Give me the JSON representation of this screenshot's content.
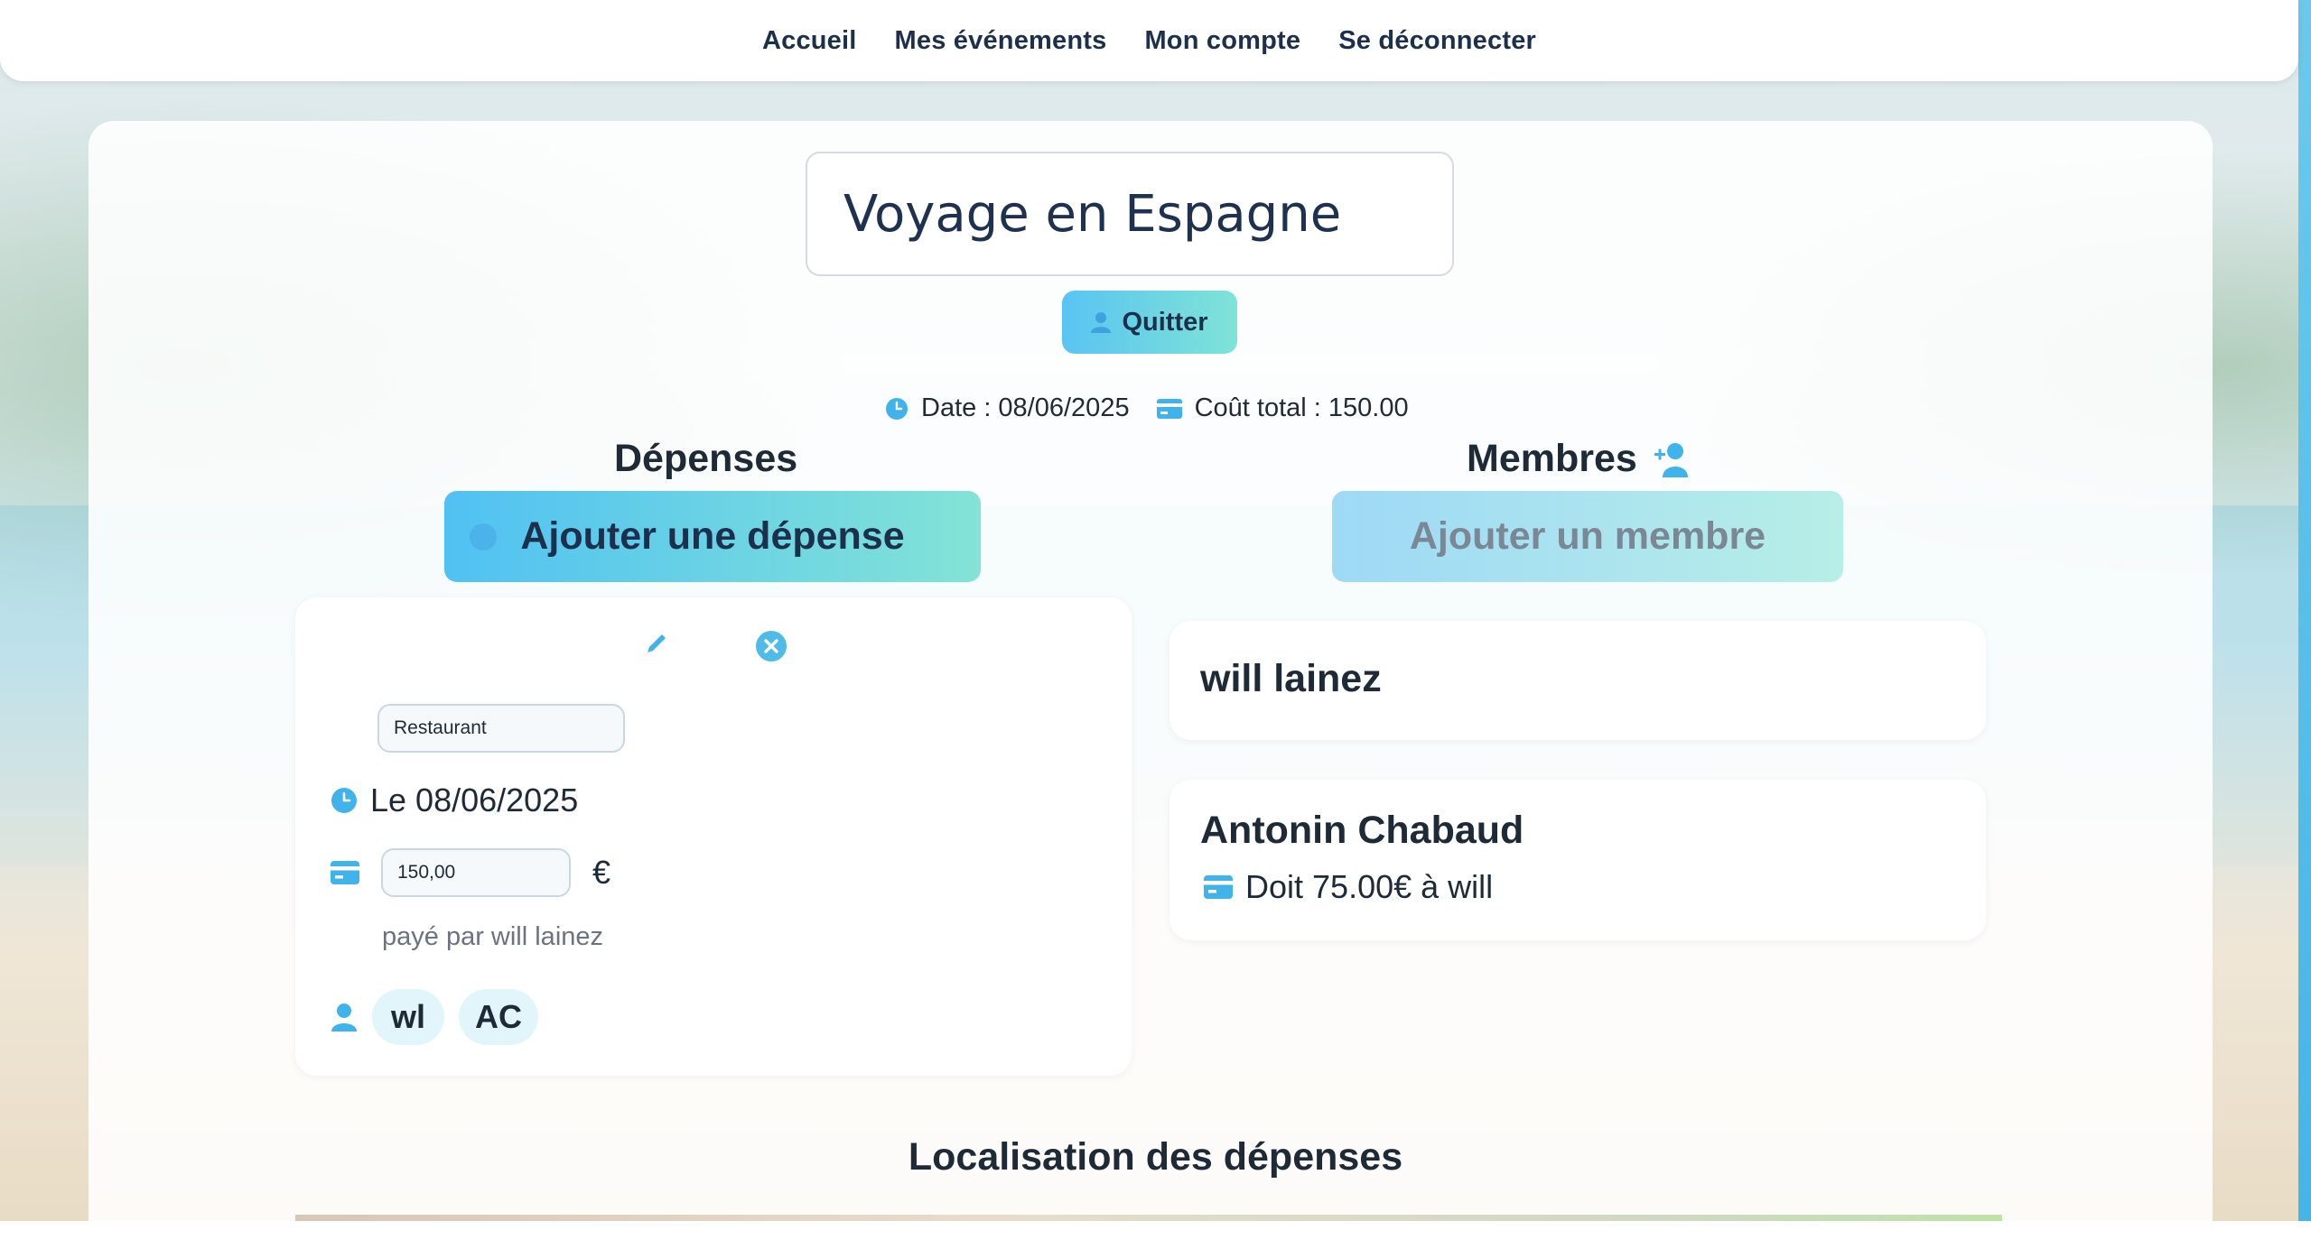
{
  "nav": {
    "items": [
      "Accueil",
      "Mes événements",
      "Mon compte",
      "Se déconnecter"
    ]
  },
  "event": {
    "title": "Voyage en Espagne",
    "quit_label": "Quitter",
    "date_text": "Date : 08/06/2025",
    "total_text": "Coût total : 150.00"
  },
  "expenses": {
    "heading": "Dépenses",
    "add_label": "Ajouter une dépense",
    "items": [
      {
        "category": "Restaurant",
        "date_text": "Le 08/06/2025",
        "amount": "150,00",
        "currency": "€",
        "paid_by": "payé par will lainez",
        "participants": [
          "wl",
          "AC"
        ]
      }
    ]
  },
  "members": {
    "heading": "Membres",
    "add_label": "Ajouter un membre",
    "items": [
      {
        "name": "will lainez",
        "debt": ""
      },
      {
        "name": "Antonin Chabaud",
        "debt": "Doit 75.00€ à will"
      }
    ]
  },
  "location": {
    "heading": "Localisation des dépenses"
  },
  "colors": {
    "accent": "#4fc1f2",
    "accent_end": "#83e3d6",
    "icon_blue": "#3fb3ea",
    "text_dark": "#1f2a37",
    "nav_text": "#1c2f4d"
  },
  "icons": {
    "quit": "user-icon",
    "date": "clock-icon",
    "total": "credit-card-icon",
    "add_member": "user-plus-icon",
    "edit": "pencil-icon",
    "delete": "close-circle-icon",
    "participants": "user-icon"
  }
}
